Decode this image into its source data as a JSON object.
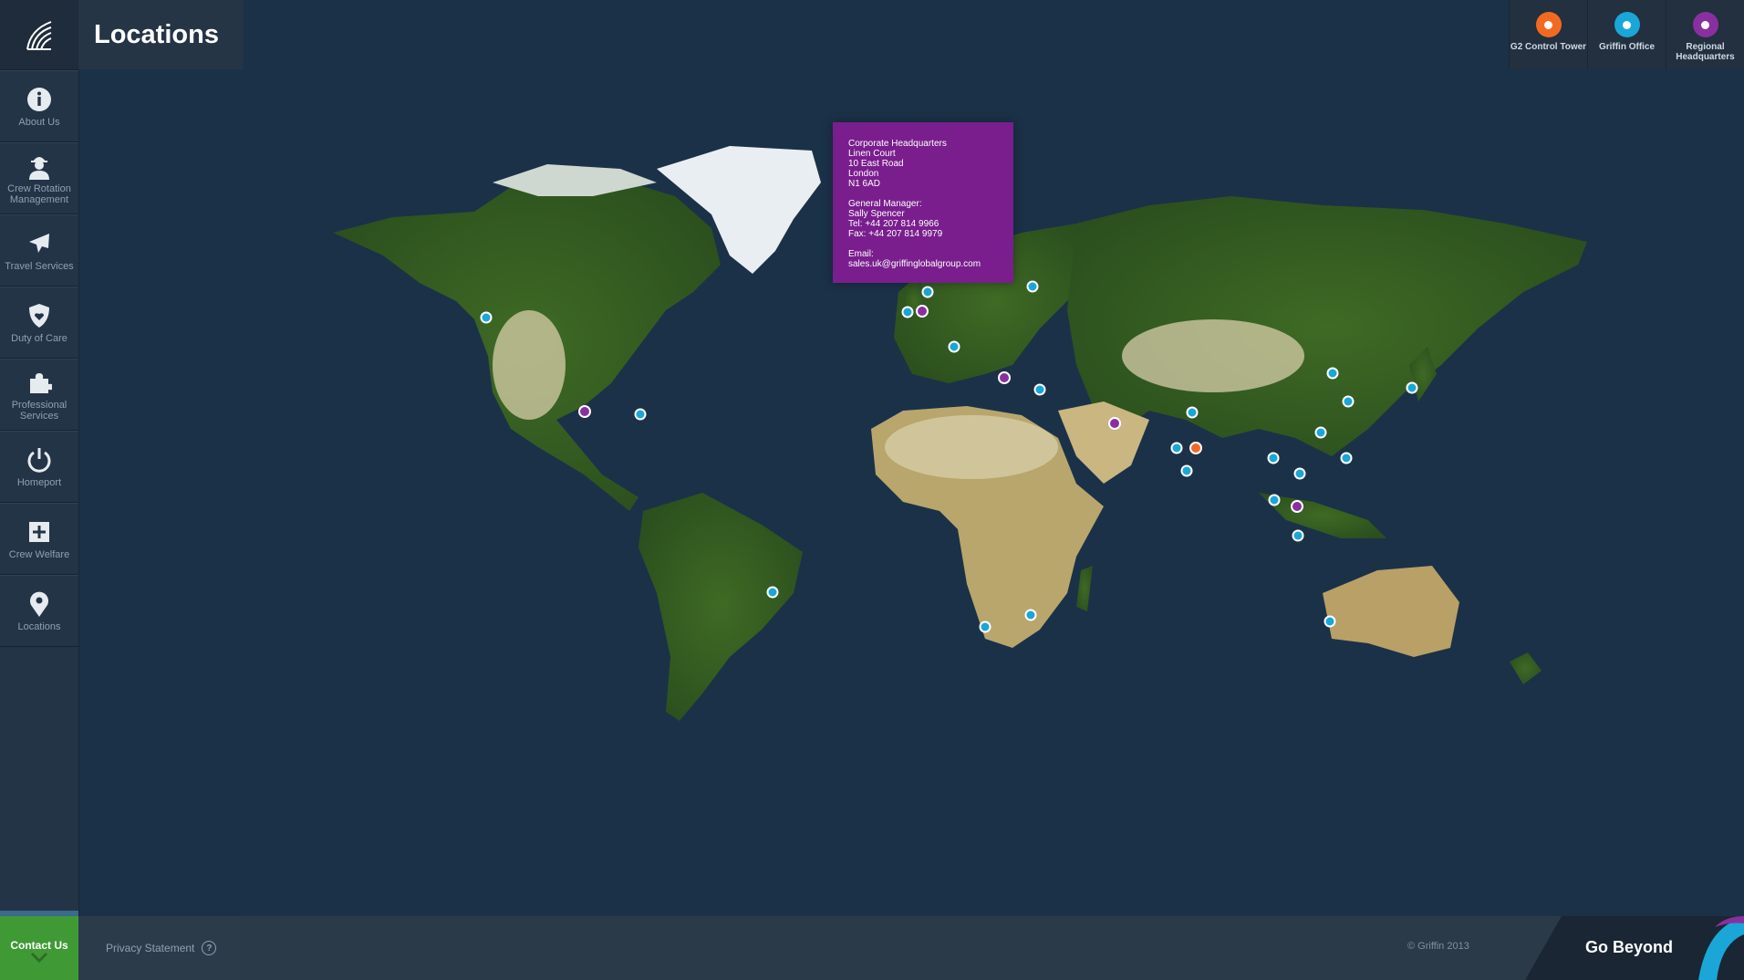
{
  "page": {
    "title": "Locations"
  },
  "sidebar": {
    "logo_icon": "griffin-logo-icon",
    "items": [
      {
        "label": "About Us",
        "icon": "info-icon"
      },
      {
        "label": "Crew Rotation Management",
        "icon": "person-icon"
      },
      {
        "label": "Travel Services",
        "icon": "airplane-icon"
      },
      {
        "label": "Duty of Care",
        "icon": "shield-icon"
      },
      {
        "label": "Professional Services",
        "icon": "puzzle-icon"
      },
      {
        "label": "Homeport",
        "icon": "power-icon"
      },
      {
        "label": "Crew Welfare",
        "icon": "plus-box-icon"
      },
      {
        "label": "Locations",
        "icon": "map-pin-icon"
      }
    ]
  },
  "legend": [
    {
      "label": "G2 Control Tower",
      "color": "#f26a21"
    },
    {
      "label": "Griffin Office",
      "color": "#1aa6d6"
    },
    {
      "label": "Regional Headquarters",
      "color": "#8a2fa0"
    }
  ],
  "popup": {
    "address": [
      "Corporate Headquarters",
      "Linen Court",
      "10 East Road",
      "London",
      "N1 6AD"
    ],
    "manager": [
      "General Manager:",
      "Sally Spencer",
      "Tel: +44 207 814 9966",
      "Fax: +44 207 814 9979"
    ],
    "email": [
      "Email:",
      "sales.uk@griffinglobalgroup.com"
    ]
  },
  "footer": {
    "contact_label": "Contact Us",
    "privacy_label": "Privacy Statement",
    "privacy_icon": "question-circle-icon",
    "copyright": "© Griffin 2013",
    "tagline": "Go Beyond"
  }
}
